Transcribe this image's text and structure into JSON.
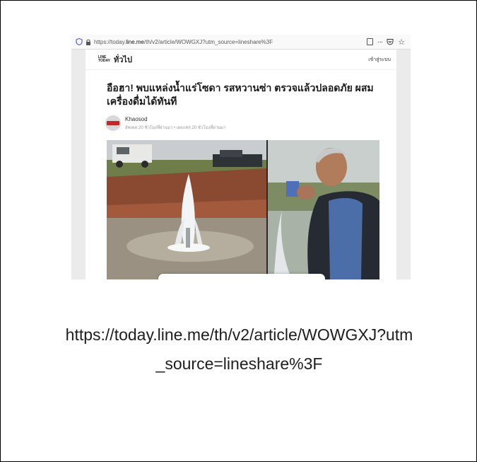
{
  "browser": {
    "url_prefix": "https://today.",
    "url_host": "line.me",
    "url_path": "/th/v2/article/WOWGXJ?utm_source=lineshare%3F",
    "toolbar_icons": [
      "reader-view-icon",
      "more-dots-icon",
      "pocket-icon",
      "bookmark-star-icon"
    ]
  },
  "site": {
    "logo_line1": "LINE",
    "logo_line2": "TODAY",
    "category": "ทั่วไป",
    "login_label": "เข้าสู่ระบบ"
  },
  "article": {
    "title": "อือฮา! พบแหล่งน้ำแร่โซดา รสหวานซ่า ตรวจแล้วปลอดภัย ผสมเครื่องดื่มได้ทันที",
    "publisher": "Khaosod",
    "date_line": "อัพเดต 20 ชั่วโมงที่ผ่านมา • เผยแพร่ 20 ชั่วโมงที่ผ่านมา"
  },
  "caption": {
    "line1": "https://today.line.me/th/v2/article/WOWGXJ?utm",
    "line2": "_source=lineshare%3F"
  },
  "colors": {
    "accent_red": "#c62828",
    "background": "#ebebeb"
  }
}
